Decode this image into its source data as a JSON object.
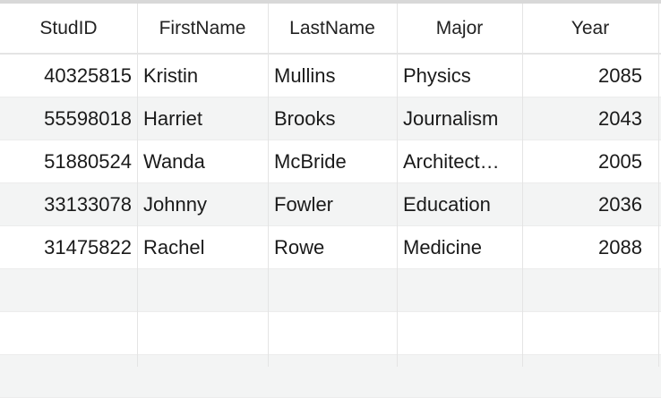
{
  "table": {
    "columns": [
      "StudID",
      "FirstName",
      "LastName",
      "Major",
      "Year"
    ],
    "rows": [
      [
        "40325815",
        "Kristin",
        "Mullins",
        "Physics",
        "2085"
      ],
      [
        "55598018",
        "Harriet",
        "Brooks",
        "Journalism",
        "2043"
      ],
      [
        "51880524",
        "Wanda",
        "McBride",
        "Architect…",
        "2005"
      ],
      [
        "33133078",
        "Johnny",
        "Fowler",
        "Education",
        "2036"
      ],
      [
        "31475822",
        "Rachel",
        "Rowe",
        "Medicine",
        "2088"
      ]
    ]
  }
}
